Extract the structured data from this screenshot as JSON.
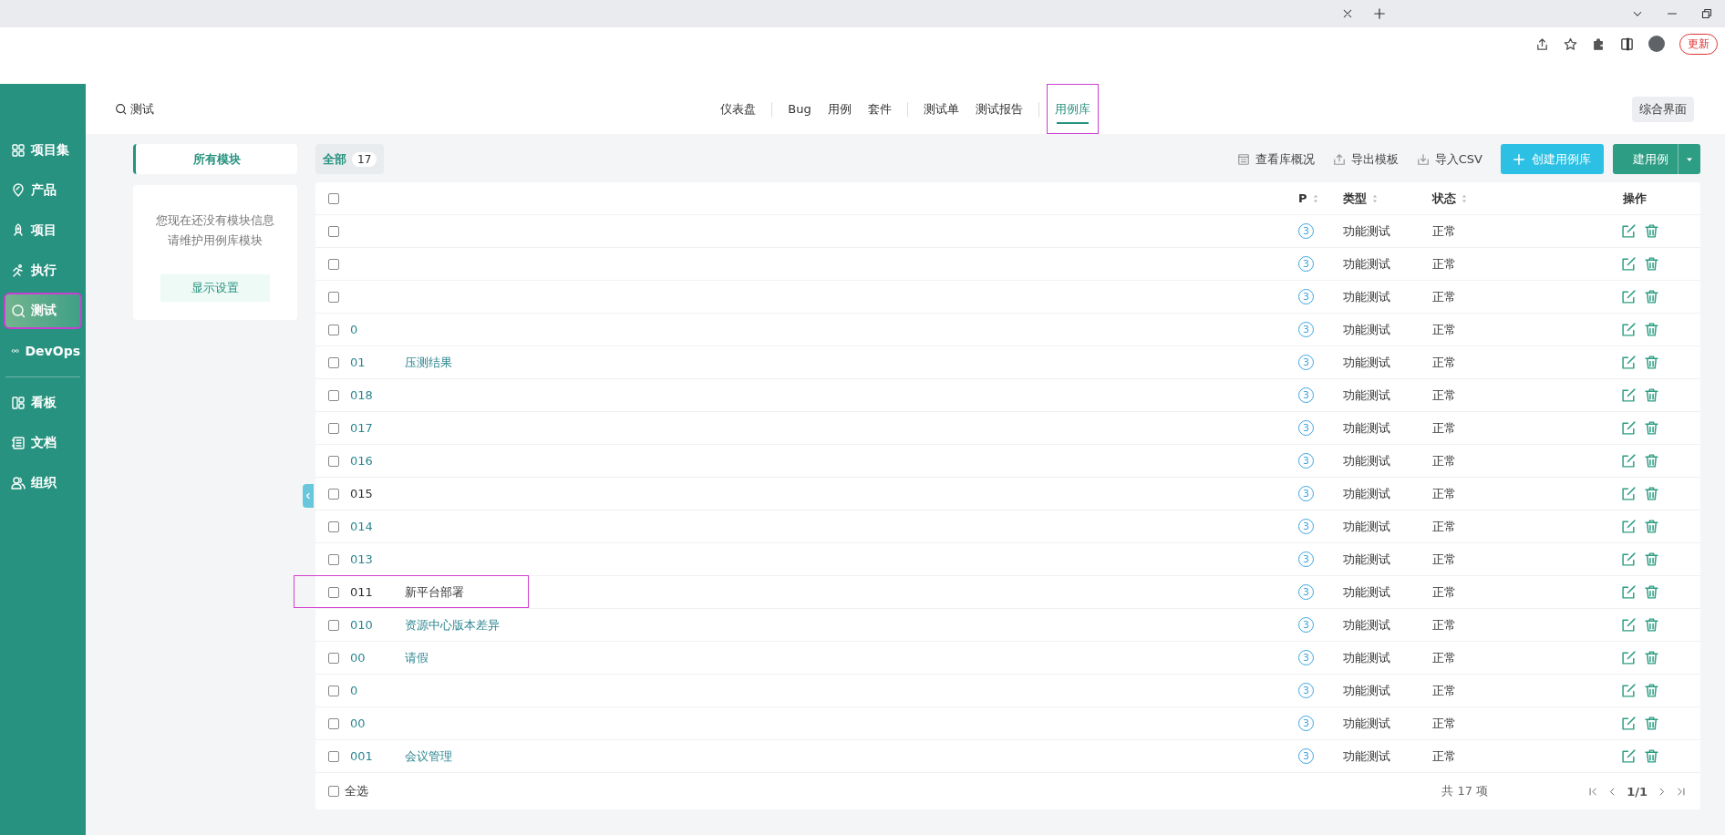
{
  "browser": {
    "update_button": "更新"
  },
  "sidebar": {
    "items": [
      {
        "label": "项目集",
        "selected": false,
        "highlighted": false
      },
      {
        "label": "产品",
        "selected": false,
        "highlighted": false
      },
      {
        "label": "项目",
        "selected": false,
        "highlighted": false
      },
      {
        "label": "执行",
        "selected": false,
        "highlighted": false
      },
      {
        "label": "测试",
        "selected": true,
        "highlighted": true
      },
      {
        "label": "DevOps",
        "selected": false,
        "highlighted": false
      },
      {
        "label": "看板",
        "selected": false,
        "highlighted": false
      },
      {
        "label": "文档",
        "selected": false,
        "highlighted": false
      },
      {
        "label": "组织",
        "selected": false,
        "highlighted": false
      }
    ]
  },
  "header": {
    "search": "测试",
    "nav": [
      {
        "label": "仪表盘",
        "selected": false,
        "highlighted": false
      },
      {
        "label": "Bug",
        "selected": false,
        "highlighted": false
      },
      {
        "label": "用例",
        "selected": false,
        "highlighted": false
      },
      {
        "label": "套件",
        "selected": false,
        "highlighted": false
      },
      {
        "label": "测试单",
        "selected": false,
        "highlighted": false
      },
      {
        "label": "测试报告",
        "selected": false,
        "highlighted": false
      },
      {
        "label": "用例库",
        "selected": true,
        "highlighted": true
      }
    ],
    "view_button": "综合界面"
  },
  "module_panel": {
    "tab": "所有模块",
    "message": [
      "您现在还没有模块信息",
      "请维护用例库模块"
    ],
    "settings_button": "显示设置"
  },
  "toolbar": {
    "tabs": [
      {
        "label": "全部",
        "count": "17",
        "selected": true
      }
    ],
    "actions": [
      "查看库概况",
      "导出模板",
      "导入CSV"
    ],
    "create_library_button": "创建用例库",
    "create_case_button": "建用例"
  },
  "table": {
    "header_checked": false,
    "columns": [
      {
        "label": "P",
        "sortable": true
      },
      {
        "label": "类型",
        "sortable": true
      },
      {
        "label": "状态",
        "sortable": true
      },
      {
        "label": "操作",
        "sortable": false
      }
    ],
    "rows": [
      {
        "checked": false,
        "highlighted": false,
        "priority": "3",
        "type": "功能测试",
        "status": "正常"
      },
      {
        "checked": false,
        "highlighted": false,
        "priority": "3",
        "type": "功能测试",
        "status": "正常"
      },
      {
        "checked": false,
        "highlighted": false,
        "priority": "3",
        "type": "功能测试",
        "status": "正常"
      },
      {
        "id": "0",
        "checked": false,
        "linked": true,
        "highlighted": false,
        "priority": "3",
        "type": "功能测试",
        "status": "正常"
      },
      {
        "id": "01",
        "title": "压测结果",
        "checked": false,
        "linked": true,
        "highlighted": false,
        "priority": "3",
        "type": "功能测试",
        "status": "正常"
      },
      {
        "id": "018",
        "checked": false,
        "linked": true,
        "highlighted": false,
        "priority": "3",
        "type": "功能测试",
        "status": "正常"
      },
      {
        "id": "017",
        "checked": false,
        "linked": true,
        "highlighted": false,
        "priority": "3",
        "type": "功能测试",
        "status": "正常"
      },
      {
        "id": "016",
        "checked": false,
        "linked": true,
        "highlighted": false,
        "priority": "3",
        "type": "功能测试",
        "status": "正常"
      },
      {
        "id": "015",
        "checked": false,
        "linked": false,
        "highlighted": false,
        "priority": "3",
        "type": "功能测试",
        "status": "正常"
      },
      {
        "id": "014",
        "checked": false,
        "linked": true,
        "highlighted": false,
        "priority": "3",
        "type": "功能测试",
        "status": "正常"
      },
      {
        "id": "013",
        "checked": false,
        "linked": true,
        "highlighted": false,
        "priority": "3",
        "type": "功能测试",
        "status": "正常"
      },
      {
        "id": "011",
        "title": "新平台部署",
        "checked": false,
        "linked": false,
        "highlighted": true,
        "priority": "3",
        "type": "功能测试",
        "status": "正常"
      },
      {
        "id": "010",
        "title": "资源中心版本差异",
        "checked": false,
        "linked": true,
        "highlighted": false,
        "priority": "3",
        "type": "功能测试",
        "status": "正常"
      },
      {
        "id": "00",
        "title": "请假",
        "checked": false,
        "linked": true,
        "highlighted": false,
        "priority": "3",
        "type": "功能测试",
        "status": "正常"
      },
      {
        "id": "0",
        "checked": false,
        "linked": true,
        "highlighted": false,
        "priority": "3",
        "type": "功能测试",
        "status": "正常"
      },
      {
        "id": "00",
        "checked": false,
        "linked": true,
        "highlighted": false,
        "priority": "3",
        "type": "功能测试",
        "status": "正常"
      },
      {
        "id": "001",
        "title": "会议管理",
        "checked": false,
        "linked": true,
        "highlighted": false,
        "priority": "3",
        "type": "功能测试",
        "status": "正常"
      }
    ],
    "footer": {
      "select_all": "全选",
      "select_all_checked": false,
      "total": "共 17 项",
      "page": "1/1"
    }
  }
}
